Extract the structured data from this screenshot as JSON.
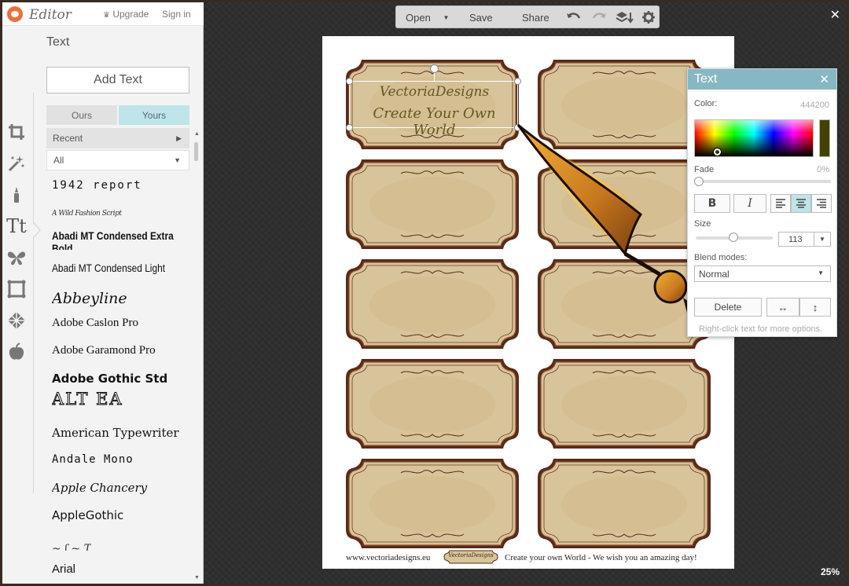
{
  "app": {
    "name": "Editor",
    "upgrade": "Upgrade",
    "signin": "Sign in"
  },
  "sidebar": {
    "title": "Text",
    "add_text": "Add Text",
    "tabs": [
      "Ours",
      "Yours"
    ],
    "filter_recent": "Recent",
    "filter_all": "All",
    "tools": [
      "crop-icon",
      "magic-wand-icon",
      "brush-icon",
      "text-icon",
      "butterfly-icon",
      "frame-icon",
      "texture-icon",
      "apple-icon"
    ],
    "text_tool_glyph": "Tt",
    "fonts": [
      "1942 report",
      "A Wild Fashion Script",
      "Abadi MT Condensed Extra Bold",
      "Abadi MT Condensed Light",
      "Abbeyline",
      "Adobe Caslon Pro",
      "Adobe Garamond Pro",
      "Adobe Gothic Std",
      "ALT EA",
      "American Typewriter",
      "Andale Mono",
      "Apple Chancery",
      "AppleGothic",
      "Arial"
    ]
  },
  "toolbar": {
    "open": "Open",
    "save": "Save",
    "share": "Share",
    "icons": [
      "undo-icon",
      "redo-icon",
      "layers-icon",
      "gear-icon"
    ]
  },
  "canvas": {
    "selected_text_line1": "VectoriaDesigns",
    "selected_text_line2": "Create Your Own World",
    "footer_url": "www.vectoriadesigns.eu",
    "footer_logo": "VectoriaDesigns",
    "footer_tagline": "Create your own World - We wish you an amazing day!",
    "label_color": "#d9c59b",
    "label_border": "#5a2a18"
  },
  "text_panel": {
    "title": "Text",
    "color_label": "Color:",
    "color_value": "444200",
    "color_hex": "#444200",
    "fade_label": "Fade",
    "fade_value": "0%",
    "bold": "B",
    "italic": "I",
    "size_label": "Size",
    "size_value": "113",
    "blend_label": "Blend modes:",
    "blend_value": "Normal",
    "delete": "Delete",
    "hint": "Right-click text for more options."
  },
  "status": {
    "zoom": "25%"
  }
}
